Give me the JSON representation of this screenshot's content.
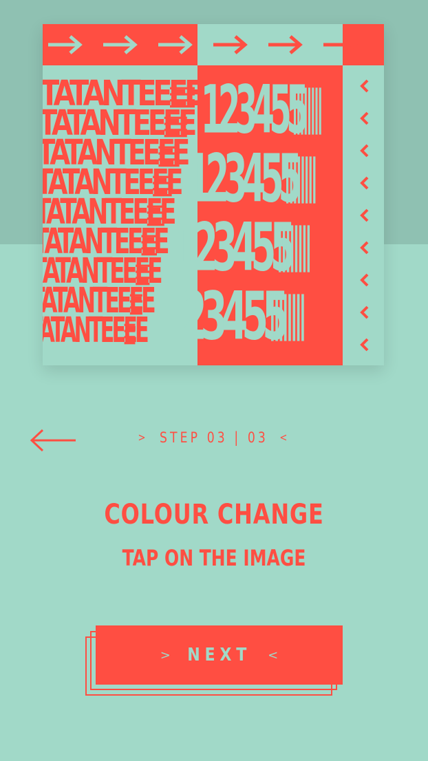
{
  "colors": {
    "accent": "#ff4e42",
    "background": "#a1d9c8",
    "top_band": "#8fc1b2"
  },
  "artwork": {
    "letters_pattern": "TATANTE",
    "numbers_pattern": "12345"
  },
  "nav": {
    "back_icon": "arrow-left-icon"
  },
  "step": {
    "left_chevron": ">",
    "label": "STEP 03 | 03",
    "right_chevron": "<"
  },
  "content": {
    "title": "COLOUR CHANGE",
    "subtitle": "TAP ON THE IMAGE"
  },
  "next_button": {
    "left_chevron": ">",
    "label": "NEXT",
    "right_chevron": "<"
  }
}
